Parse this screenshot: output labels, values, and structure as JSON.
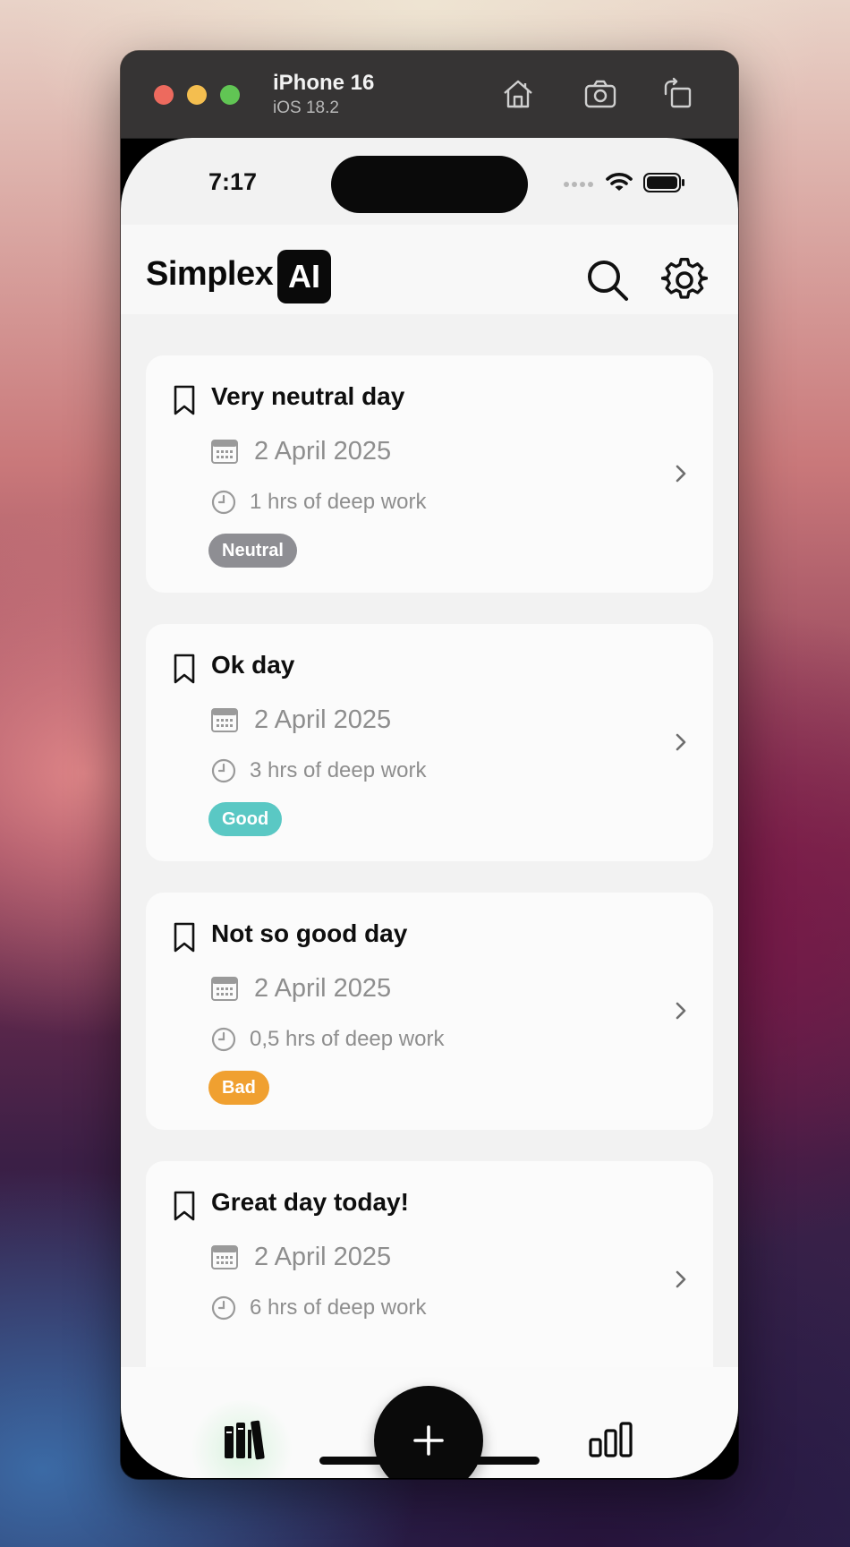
{
  "simulator": {
    "device_name": "iPhone 16",
    "os_version": "iOS 18.2",
    "icons": [
      "home-icon",
      "screenshot-icon",
      "rotate-icon"
    ]
  },
  "status_bar": {
    "time": "7:17"
  },
  "header": {
    "logo_text": "Simplex",
    "logo_badge": "AI",
    "icons": [
      "search-icon",
      "gear-icon"
    ]
  },
  "entries": [
    {
      "title": "Very neutral day",
      "date": "2 April 2025",
      "deep_work": "1 hrs of deep work",
      "mood": "Neutral",
      "mood_color": "#8e8e93"
    },
    {
      "title": "Ok day",
      "date": "2 April 2025",
      "deep_work": "3 hrs of deep work",
      "mood": "Good",
      "mood_color": "#5ac8c4"
    },
    {
      "title": "Not so good day",
      "date": "2 April 2025",
      "deep_work": "0,5 hrs of deep work",
      "mood": "Bad",
      "mood_color": "#f0a030"
    },
    {
      "title": "Great day today!",
      "date": "2 April 2025",
      "deep_work": "6 hrs of deep work",
      "mood": "",
      "mood_color": ""
    }
  ],
  "tab_bar": {
    "icons": [
      "library-icon",
      "plus-icon",
      "stats-icon"
    ]
  }
}
